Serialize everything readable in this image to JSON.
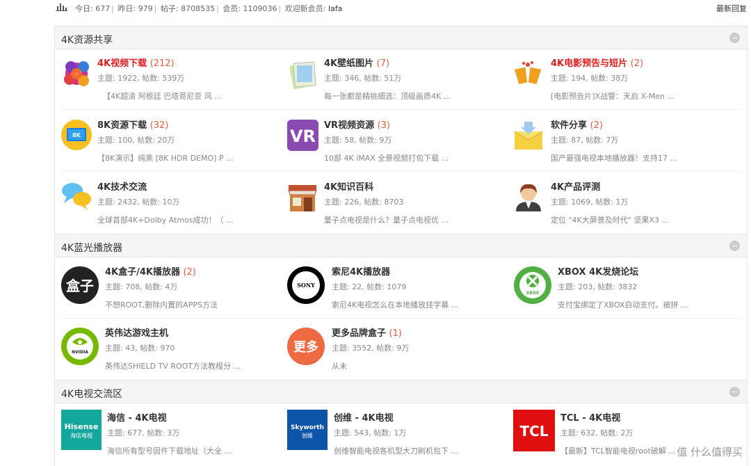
{
  "topbar": {
    "today_label": "今日:",
    "today_value": "677",
    "yesterday_label": "昨日:",
    "yesterday_value": "979",
    "posts_label": "帖子:",
    "posts_value": "8708535",
    "members_label": "会员:",
    "members_value": "1109036",
    "welcome_label": "欢迎新会员:",
    "welcome_value": "lafa",
    "latest_reply": "最新回复"
  },
  "sections": [
    {
      "title": "4K资源共享",
      "forums": [
        {
          "name": "4K视频下载",
          "count": "(212)",
          "meta": "主题: 1922, 帖数: 539万",
          "last": "【4K超清 阿根廷 巴塔哥尼亚 风 ...",
          "icon": "flower-film-icon",
          "red": true
        },
        {
          "name": "4K壁纸图片",
          "count": "(7)",
          "meta": "主题: 346, 帖数: 51万",
          "last": "每一张都是精挑细选：顶级画质4K ...",
          "icon": "wallpaper-icon",
          "red": false
        },
        {
          "name": "4K电影预告与短片",
          "count": "(2)",
          "meta": "主题: 194, 帖数: 38万",
          "last": "[电影预告片]X战警：天启 X-Men ...",
          "icon": "cheers-icon",
          "red": true
        },
        {
          "name": "8K资源下载",
          "count": "(32)",
          "meta": "主题: 100, 帖数: 20万",
          "last": "【8K演示】纯黑 [8K HDR DEMO] P ...",
          "icon": "8k-tv-icon",
          "red": false
        },
        {
          "name": "VR视频资源",
          "count": "(3)",
          "meta": "主题: 58, 帖数: 9万",
          "last": "10部 4K iMAX 全景视频打包下载 ...",
          "icon": "vr-icon",
          "red": false
        },
        {
          "name": "软件分享",
          "count": "(2)",
          "meta": "主题: 87, 帖数: 7万",
          "last": "国产最强电视本地播放器！支持17 ...",
          "icon": "software-box-icon",
          "red": false
        },
        {
          "name": "4K技术交流",
          "count": "",
          "meta": "主题: 2432, 帖数: 10万",
          "last": "全球首部4K+Dolby Atmos成功！（ ...",
          "icon": "chat-bubbles-icon",
          "red": false
        },
        {
          "name": "4K知识百科",
          "count": "",
          "meta": "主题: 226, 帖数: 8703",
          "last": "量子点电视是什么？量子点电视优 ...",
          "icon": "shop-icon",
          "red": false
        },
        {
          "name": "4K产品评测",
          "count": "",
          "meta": "主题: 1069, 帖数: 1万",
          "last": "定位 \"4K大屏普及时代\"  坚果X3 ...",
          "icon": "reviewer-icon",
          "red": false
        }
      ]
    },
    {
      "title": "4K蓝光播放器",
      "forums": [
        {
          "name": "4K盒子/4K播放器",
          "count": "(2)",
          "meta": "主题: 708, 帖数: 4万",
          "last": "不想ROOT,删除内置的APPS方法",
          "icon": "box-logo-icon",
          "logo_text": "盒子"
        },
        {
          "name": "索尼4K播放器",
          "count": "",
          "meta": "主题: 22, 帖数: 1079",
          "last": "索尼4K电视怎么在本地播放挂字幕 ...",
          "icon": "sony-logo-icon",
          "logo_text": "SONY"
        },
        {
          "name": "XBOX 4K发烧论坛",
          "count": "",
          "meta": "主题: 203, 帖数: 3832",
          "last": "支付宝绑定了XBOX自动支付。被拼 ...",
          "icon": "xbox-logo-icon",
          "logo_text": "XBOX"
        },
        {
          "name": "英伟达游戏主机",
          "count": "",
          "meta": "主题: 43, 帖数: 970",
          "last": "英伟达SHIELD TV ROOT方法教程分 ...",
          "icon": "nvidia-logo-icon",
          "logo_text": "NVIDIA"
        },
        {
          "name": "更多品牌盒子",
          "count": "(1)",
          "meta": "主题: 3552, 帖数: 9万",
          "last": "从未",
          "icon": "more-brands-icon",
          "logo_text": "更多"
        }
      ]
    },
    {
      "title": "4K电视交流区",
      "forums": [
        {
          "name": "海信 - 4K电视",
          "count": "",
          "meta": "主题: 677, 帖数: 3万",
          "last": "海信所有型号固件下载地址（大全 ...",
          "icon": "hisense-logo-icon",
          "logo_text": "Hisense",
          "logo_sub": "海信电视"
        },
        {
          "name": "创维 - 4K电视",
          "count": "",
          "meta": "主题: 543, 帖数: 1万",
          "last": "创维智能电视各机型大刀刷机包下 ...",
          "icon": "skyworth-logo-icon",
          "logo_text": "Skyworth",
          "logo_sub": "创维"
        },
        {
          "name": "TCL - 4K电视",
          "count": "",
          "meta": "主题: 632, 帖数: 2万",
          "last": "【最新】TCL智能电视root破解 ...",
          "icon": "tcl-logo-icon",
          "logo_text": "TCL"
        }
      ]
    }
  ],
  "watermark": "值 什么值得买",
  "colors": {
    "accent_red": "#e02020",
    "count_orange": "#e06040",
    "header_bg": "#f5f5f5"
  }
}
